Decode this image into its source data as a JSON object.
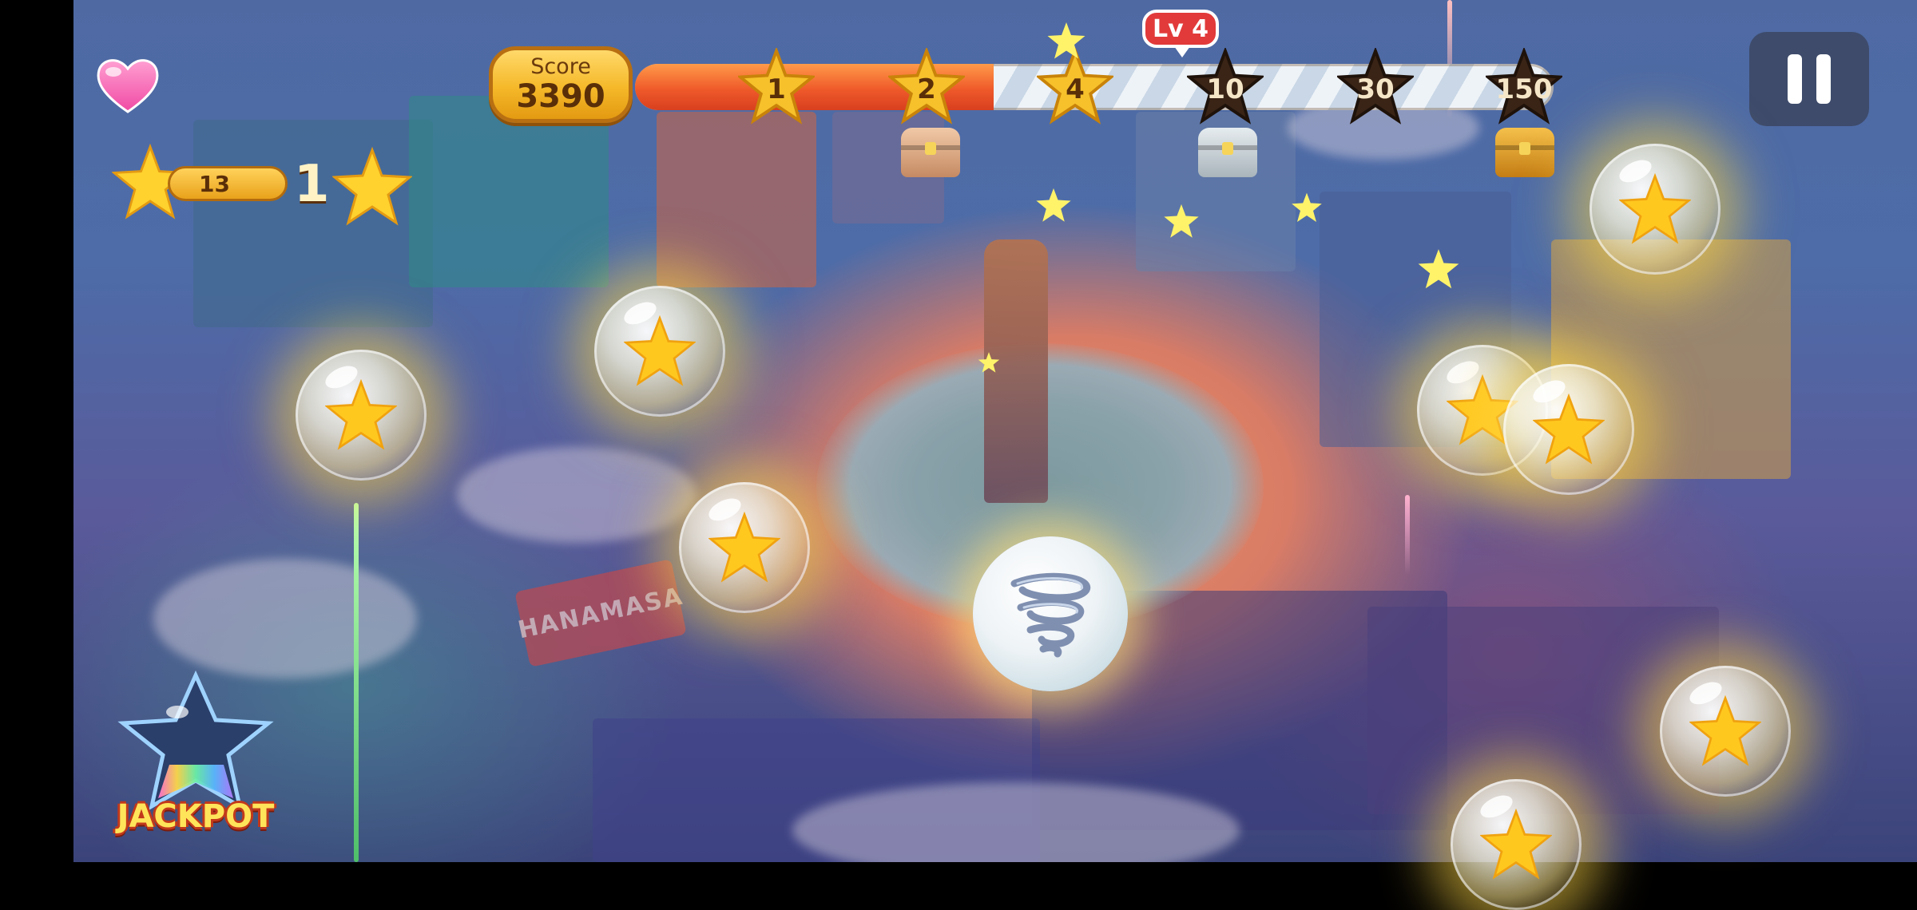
{
  "hud": {
    "score_label": "Score",
    "score_value": "3390",
    "level_badge": "Lv 4",
    "progress_fraction": 0.39,
    "milestones": [
      {
        "label": "1",
        "reached": true
      },
      {
        "label": "2",
        "reached": true
      },
      {
        "label": "4",
        "reached": true
      },
      {
        "label": "10",
        "reached": false
      },
      {
        "label": "30",
        "reached": false
      },
      {
        "label": "150",
        "reached": false
      }
    ],
    "pause_icon": "pause-icon",
    "lives_icon": "heart-icon"
  },
  "star_counter": {
    "count": "13",
    "multiplier": "1"
  },
  "jackpot": {
    "label": "JACKPOT"
  },
  "scene": {
    "sign_text": "HANAMASA"
  },
  "colors": {
    "gold": "#f6c12b",
    "fill_orange": "#ef5a2a",
    "badge_red": "#e23a3a",
    "dark_star": "#3a2416"
  }
}
